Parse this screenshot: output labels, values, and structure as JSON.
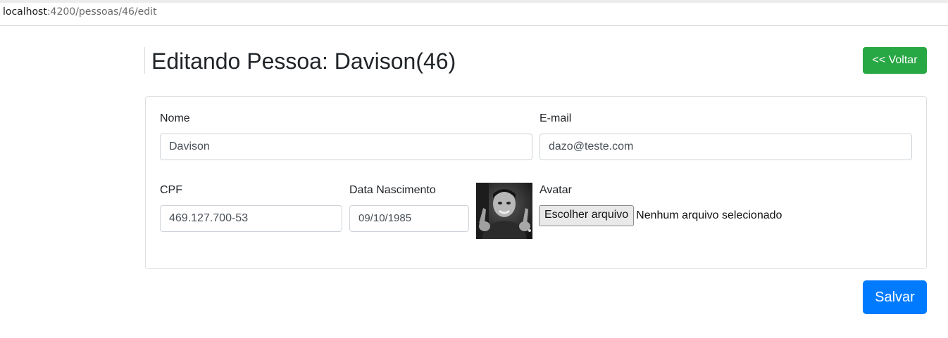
{
  "browser": {
    "url_host": "localhost",
    "url_path": ":4200/pessoas/46/edit"
  },
  "header": {
    "title": "Editando Pessoa: Davison(46)",
    "back_button": "<< Voltar"
  },
  "form": {
    "nome": {
      "label": "Nome",
      "value": "Davison"
    },
    "email": {
      "label": "E-mail",
      "value": "dazo@teste.com"
    },
    "cpf": {
      "label": "CPF",
      "value": "469.127.700-53"
    },
    "data_nascimento": {
      "label": "Data Nascimento",
      "value": "09/10/1985"
    },
    "avatar": {
      "label": "Avatar",
      "choose_button": "Escolher arquivo",
      "status": "Nenhum arquivo selecionado"
    }
  },
  "actions": {
    "save_button": "Salvar"
  },
  "colors": {
    "success": "#28a745",
    "primary": "#007bff",
    "border": "#ced4da"
  },
  "icons": {
    "avatar": "person-photo"
  }
}
